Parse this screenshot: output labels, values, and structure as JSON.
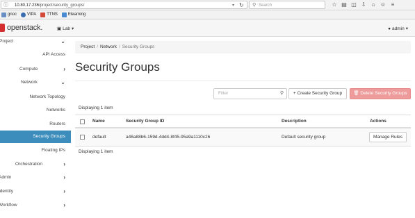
{
  "browser": {
    "url_host": "10.80.17.236",
    "url_path": "/project/security_groups/",
    "search_placeholder": "Search",
    "bookmarks": [
      {
        "label": "gnoc",
        "color": "#6a8fc4"
      },
      {
        "label": "VIPA",
        "color": "#3a6db0"
      },
      {
        "label": "TTNS",
        "color": "#d34a3a"
      },
      {
        "label": "Elearning",
        "color": "#4a8ad0"
      }
    ]
  },
  "header": {
    "logo": "openstack.",
    "project_selector": "Lab",
    "user_menu": "admin"
  },
  "sidebar": {
    "items": [
      {
        "label": "Project",
        "indent": 0,
        "chevron": "⌄"
      },
      {
        "label": "API Access",
        "indent": 2,
        "chevron": ""
      },
      {
        "label": "Compute",
        "indent": 1,
        "chevron": "›"
      },
      {
        "label": "Network",
        "indent": 1,
        "chevron": "⌄"
      },
      {
        "label": "Network Topology",
        "indent": 2,
        "chevron": ""
      },
      {
        "label": "Networks",
        "indent": 2,
        "chevron": ""
      },
      {
        "label": "Routers",
        "indent": 2,
        "chevron": ""
      },
      {
        "label": "Security Groups",
        "indent": 2,
        "chevron": "",
        "active": true
      },
      {
        "label": "Floating IPs",
        "indent": 2,
        "chevron": ""
      },
      {
        "label": "Orchestration",
        "indent": 1,
        "chevron": "›"
      },
      {
        "label": "Admin",
        "indent": 0,
        "chevron": "›"
      },
      {
        "label": "Identity",
        "indent": 0,
        "chevron": "›"
      },
      {
        "label": "Workflow",
        "indent": 0,
        "chevron": "›"
      }
    ]
  },
  "main": {
    "breadcrumb": [
      "Project",
      "Network",
      "Security Groups"
    ],
    "title": "Security Groups",
    "filter_placeholder": "Filter",
    "create_label": "+ Create Security Group",
    "delete_label": "Delete Security Groups",
    "displaying_top": "Displaying 1 item",
    "displaying_bottom": "Displaying 1 item",
    "table": {
      "columns": [
        "Name",
        "Security Group ID",
        "Description",
        "Actions"
      ],
      "rows": [
        {
          "name": "default",
          "id": "a46a88b6-159d-4dd4-8f45-95a9a1110c26",
          "description": "Default security group",
          "action": "Manage Rules"
        }
      ]
    }
  },
  "colors": {
    "active_sidebar": "#3c8dbc",
    "brand_red": "#d32f2f",
    "delete_button": "#ee9b9b"
  }
}
